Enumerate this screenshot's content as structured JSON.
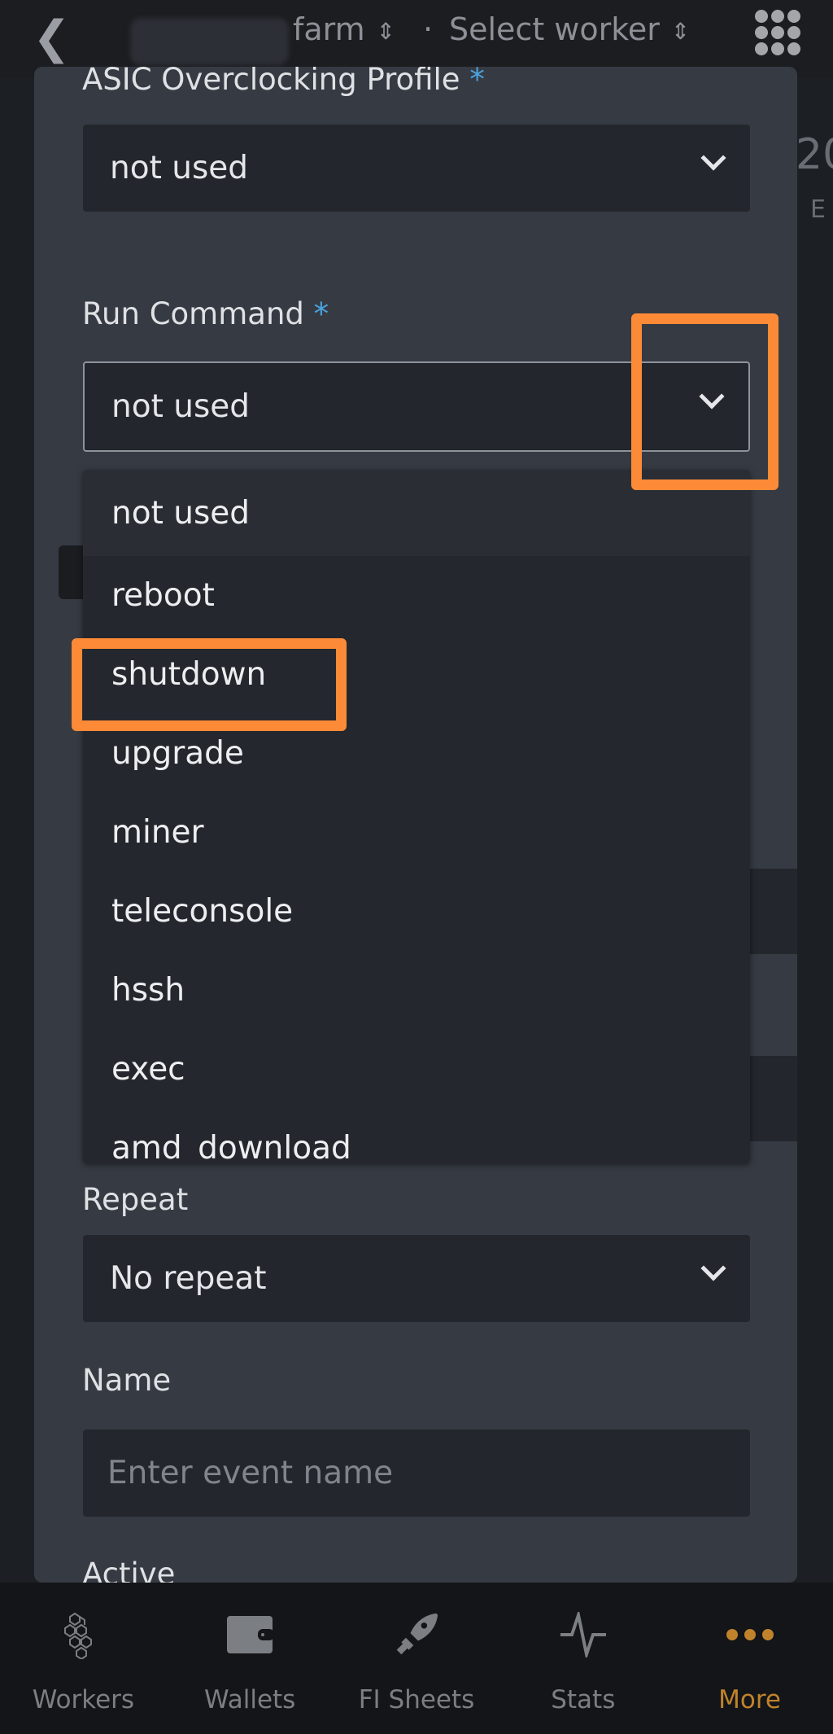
{
  "header": {
    "farm": "farm",
    "worker": "Select worker"
  },
  "background": {
    "partial_value": "20",
    "partial_label": "E"
  },
  "form": {
    "asic_label": "ASIC Overclocking Profile",
    "asic_value": "not used",
    "required_mark": "*",
    "run_label": "Run Command",
    "run_value": "not used",
    "run_options": [
      "not used",
      "reboot",
      "shutdown",
      "upgrade",
      "miner",
      "teleconsole",
      "hssh",
      "exec",
      "amd_download"
    ],
    "repeat_label": "Repeat",
    "repeat_value": "No repeat",
    "name_label": "Name",
    "name_placeholder": "Enter event name",
    "active_label": "Active"
  },
  "nav": [
    {
      "label": "Workers",
      "icon": "hexagons-icon"
    },
    {
      "label": "Wallets",
      "icon": "wallet-icon"
    },
    {
      "label": "FI Sheets",
      "icon": "rocket-icon"
    },
    {
      "label": "Stats",
      "icon": "pulse-icon"
    },
    {
      "label": "More",
      "icon": "more-dots-icon",
      "active": true
    }
  ],
  "colors": {
    "highlight": "#fd8a36",
    "accent": "#c0832c",
    "required": "#4aa3df"
  }
}
